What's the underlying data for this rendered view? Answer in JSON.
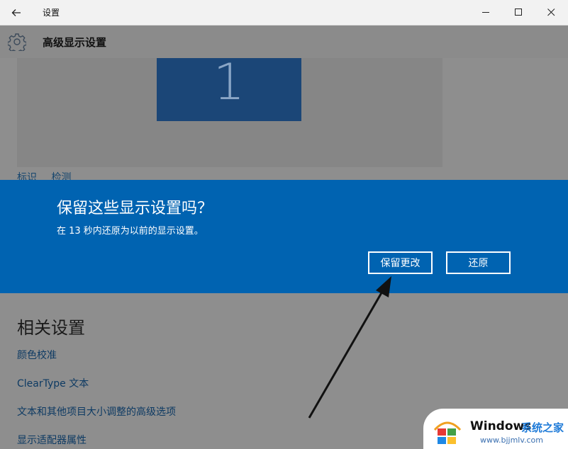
{
  "window": {
    "title": "设置",
    "controls": {
      "back": "back-arrow-icon",
      "minimize": "minimize-icon",
      "maximize": "maximize-icon",
      "close": "close-icon"
    }
  },
  "header": {
    "icon": "gear-icon",
    "title": "高级显示设置"
  },
  "display": {
    "monitor_number": "1",
    "identify_label": "标识",
    "detect_label": "检测"
  },
  "dialog": {
    "title": "保留这些显示设置吗？",
    "message": "在 13 秒内还原为以前的显示设置。",
    "keep_label": "保留更改",
    "revert_label": "还原",
    "background_color": "#0063b1"
  },
  "related": {
    "title": "相关设置",
    "links": [
      "颜色校准",
      "ClearType 文本",
      "文本和其他项目大小调整的高级选项",
      "显示适配器属性"
    ]
  },
  "watermark": {
    "brand": "Windows",
    "brand_cn": "系统之家",
    "url": "www.bjjmlv.com"
  }
}
